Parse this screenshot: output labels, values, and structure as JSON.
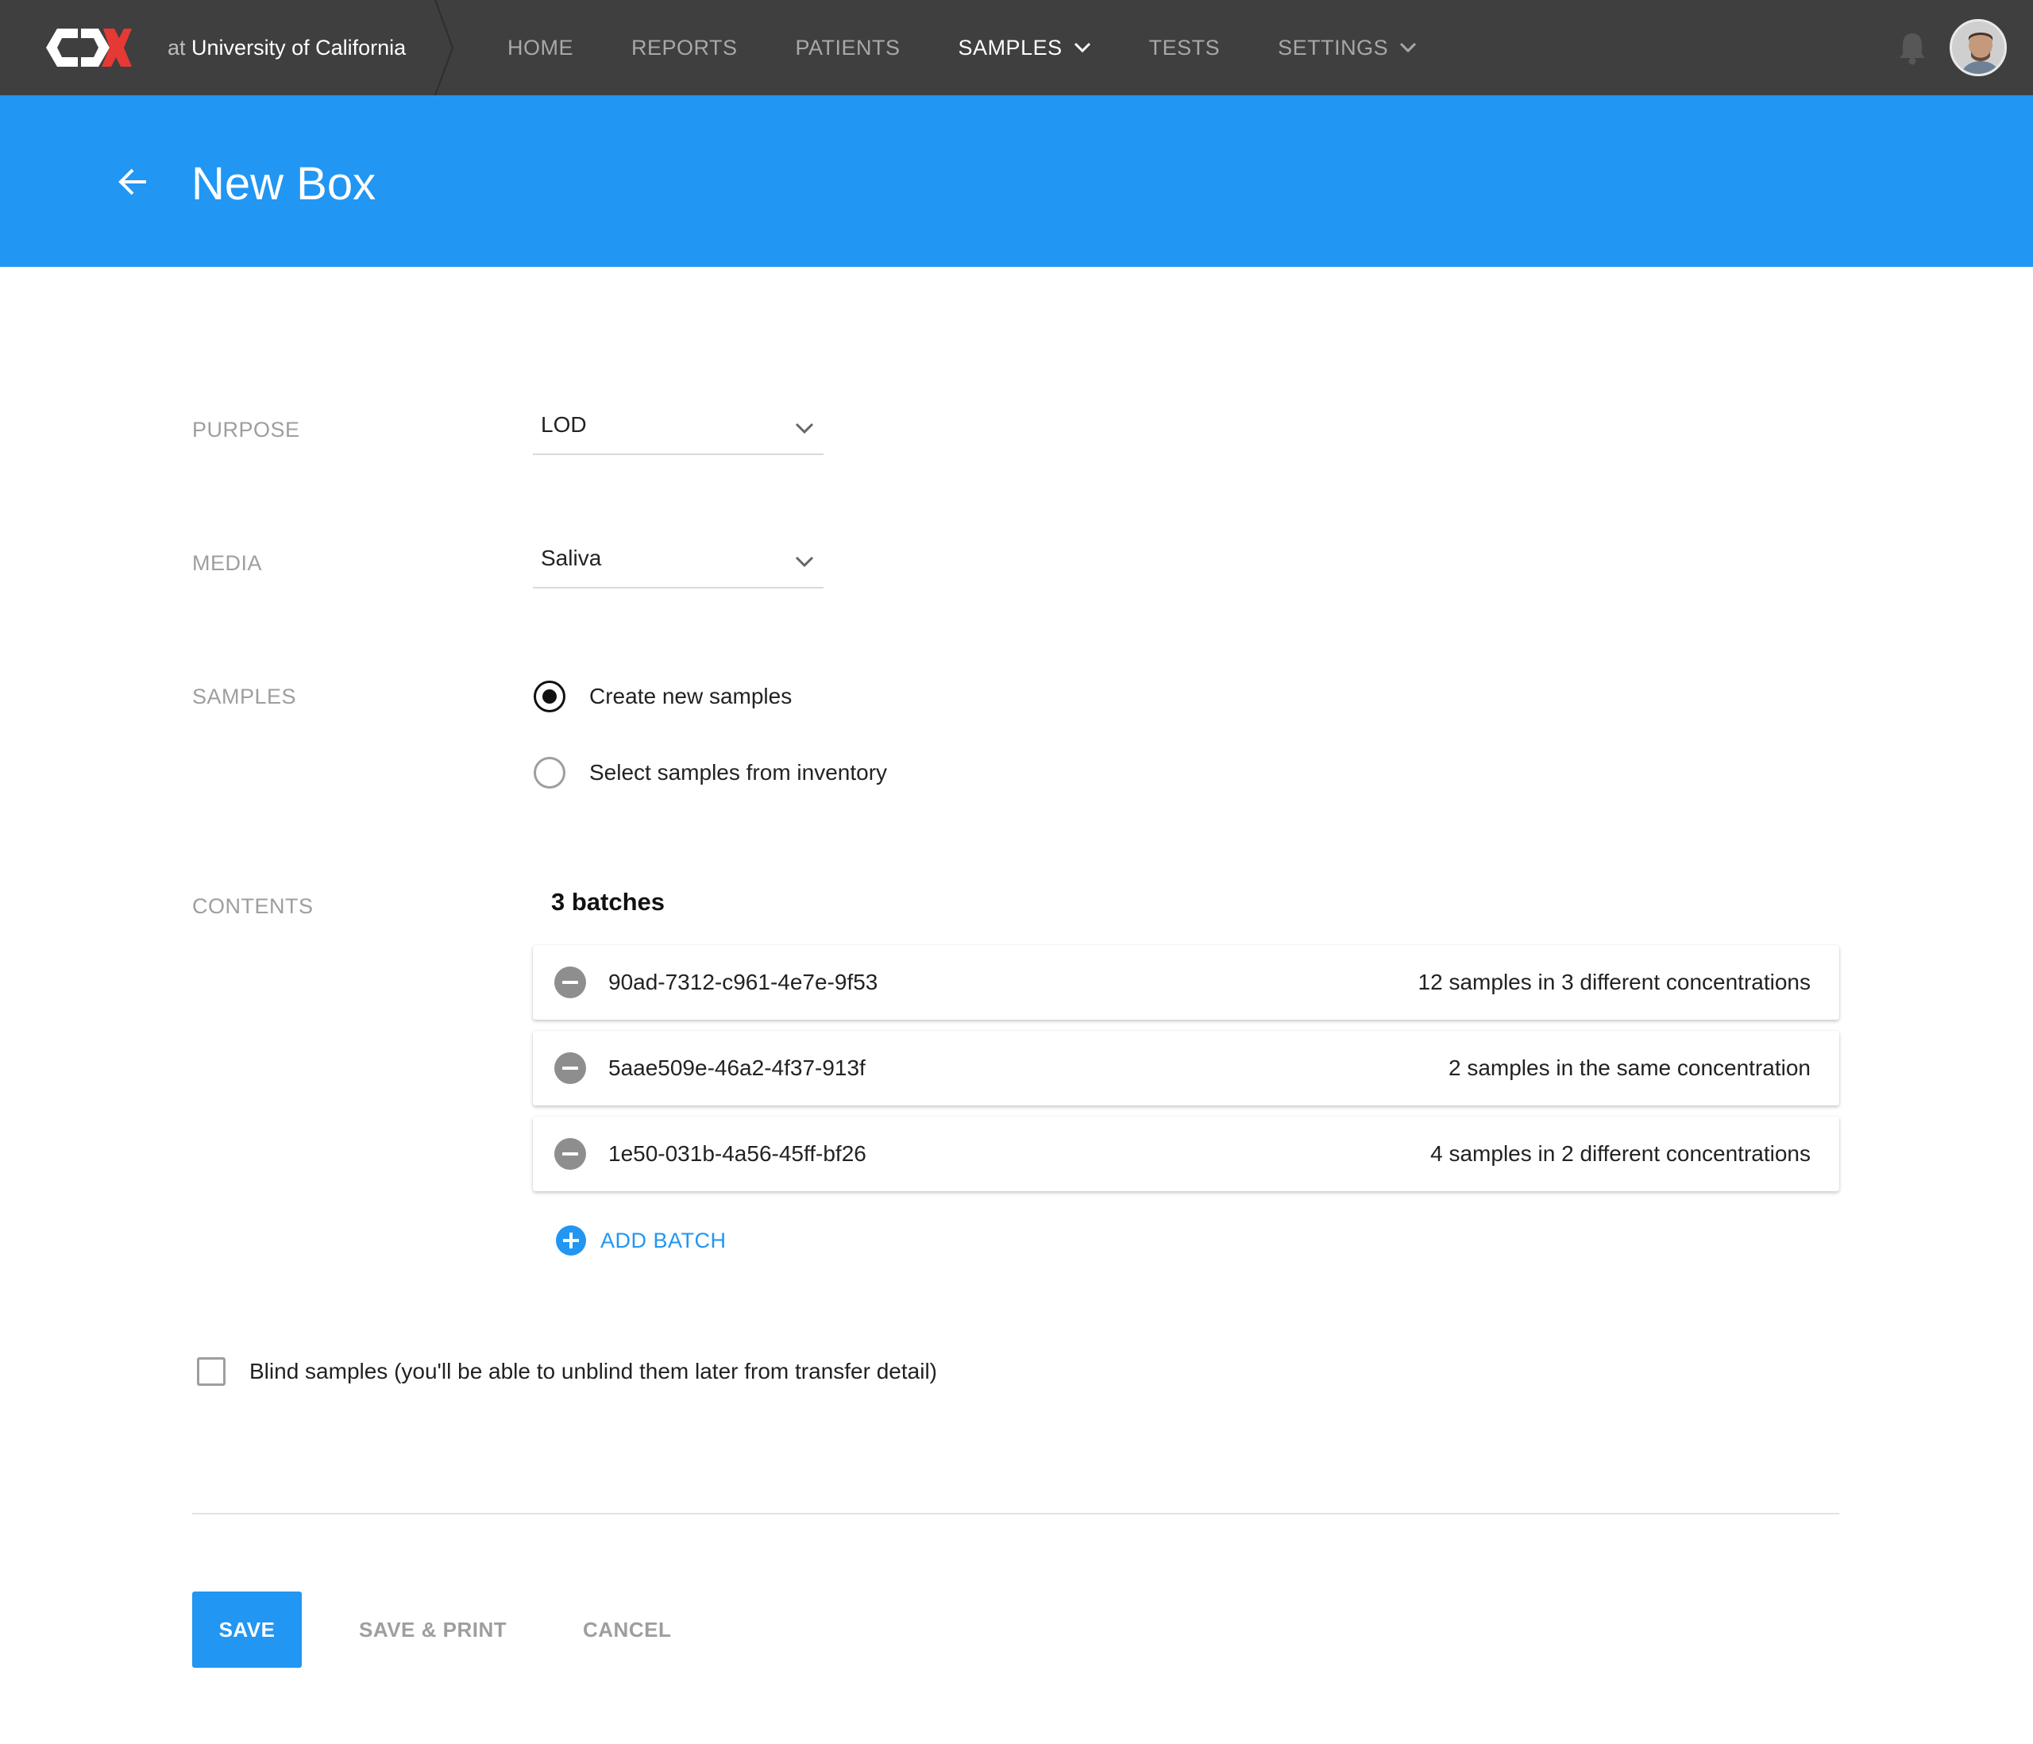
{
  "app": {
    "logo_text": "CDX",
    "institution_prefix": "at",
    "institution_name": "University of California"
  },
  "nav": {
    "items": [
      {
        "label": "HOME",
        "active": false,
        "dropdown": false
      },
      {
        "label": "REPORTS",
        "active": false,
        "dropdown": false
      },
      {
        "label": "PATIENTS",
        "active": false,
        "dropdown": false
      },
      {
        "label": "SAMPLES",
        "active": true,
        "dropdown": true
      },
      {
        "label": "TESTS",
        "active": false,
        "dropdown": false
      },
      {
        "label": "SETTINGS",
        "active": false,
        "dropdown": true
      }
    ],
    "notifications_icon": "bell-icon",
    "avatar_icon": "user-avatar"
  },
  "header": {
    "back_icon": "arrow-left-icon",
    "title": "New Box"
  },
  "form": {
    "purpose": {
      "label": "PURPOSE",
      "value": "LOD"
    },
    "media": {
      "label": "MEDIA",
      "value": "Saliva"
    },
    "samples": {
      "label": "SAMPLES",
      "options": [
        {
          "label": "Create new samples",
          "checked": true
        },
        {
          "label": "Select samples from inventory",
          "checked": false
        }
      ]
    },
    "contents": {
      "label": "CONTENTS",
      "count_text": "3 batches",
      "batches": [
        {
          "id": "90ad-7312-c961-4e7e-9f53",
          "description": "12 samples in 3 different concentrations"
        },
        {
          "id": "5aae509e-46a2-4f37-913f",
          "description": "2 samples in the same concentration"
        },
        {
          "id": "1e50-031b-4a56-45ff-bf26",
          "description": "4 samples in 2 different concentrations"
        }
      ],
      "add_label": "ADD BATCH"
    },
    "blind": {
      "label": "Blind samples (you'll be able to unblind them later from transfer detail)",
      "checked": false
    }
  },
  "actions": {
    "save": "SAVE",
    "save_print": "SAVE & PRINT",
    "cancel": "CANCEL"
  },
  "colors": {
    "topbar": "#3f3f3f",
    "accent": "#2196f3",
    "logo_red": "#e53935",
    "muted_text": "#9e9e9e"
  }
}
